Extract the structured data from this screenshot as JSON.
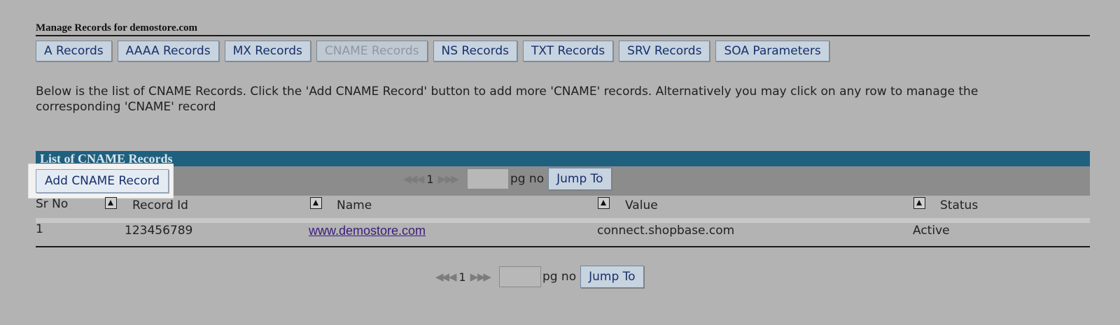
{
  "page": {
    "title": "Manage Records for demostore.com"
  },
  "tabs": [
    {
      "label": "A Records",
      "state": "normal"
    },
    {
      "label": "AAAA Records",
      "state": "normal"
    },
    {
      "label": "MX Records",
      "state": "normal"
    },
    {
      "label": "CNAME Records",
      "state": "disabled"
    },
    {
      "label": "NS Records",
      "state": "normal"
    },
    {
      "label": "TXT Records",
      "state": "normal"
    },
    {
      "label": "SRV Records",
      "state": "normal"
    },
    {
      "label": "SOA Parameters",
      "state": "normal"
    }
  ],
  "intro": {
    "text": "Below is the list of CNAME Records. Click the 'Add CNAME Record' button to add more 'CNAME' records. Alternatively you may click on any row to manage the corresponding 'CNAME' record"
  },
  "list": {
    "header": "List of CNAME Records",
    "add_button": "Add CNAME Record",
    "pager_top": {
      "nav_prev_icons": "◀◀ ◀",
      "page": "1",
      "nav_next_icons": "▶ ▶▶",
      "pg_label": "pg no",
      "jump_label": "Jump To",
      "input_value": ""
    },
    "pager_bottom": {
      "nav_prev_icons": "◀◀ ◀",
      "page": "1",
      "nav_next_icons": "▶ ▶▶",
      "pg_label": "pg no",
      "jump_label": "Jump To",
      "input_value": ""
    },
    "columns": {
      "sr_no": "Sr No",
      "record_id": "Record Id",
      "name": "Name",
      "value": "Value",
      "status": "Status"
    },
    "rows": [
      {
        "sr_no": "1",
        "record_id": "123456789",
        "name": "www.demostore.com",
        "value": "connect.shopbase.com",
        "status": "Active"
      }
    ]
  },
  "icons": {
    "sort": "sort-ascending-icon",
    "first": "first-page-icon",
    "prev": "prev-page-icon",
    "next": "next-page-icon",
    "last": "last-page-icon"
  },
  "colors": {
    "background": "#b3b3b3",
    "header_bar": "#1f607f",
    "button_bg": "#c7d3df",
    "button_text": "#17306b",
    "link": "#3b1d7a"
  }
}
